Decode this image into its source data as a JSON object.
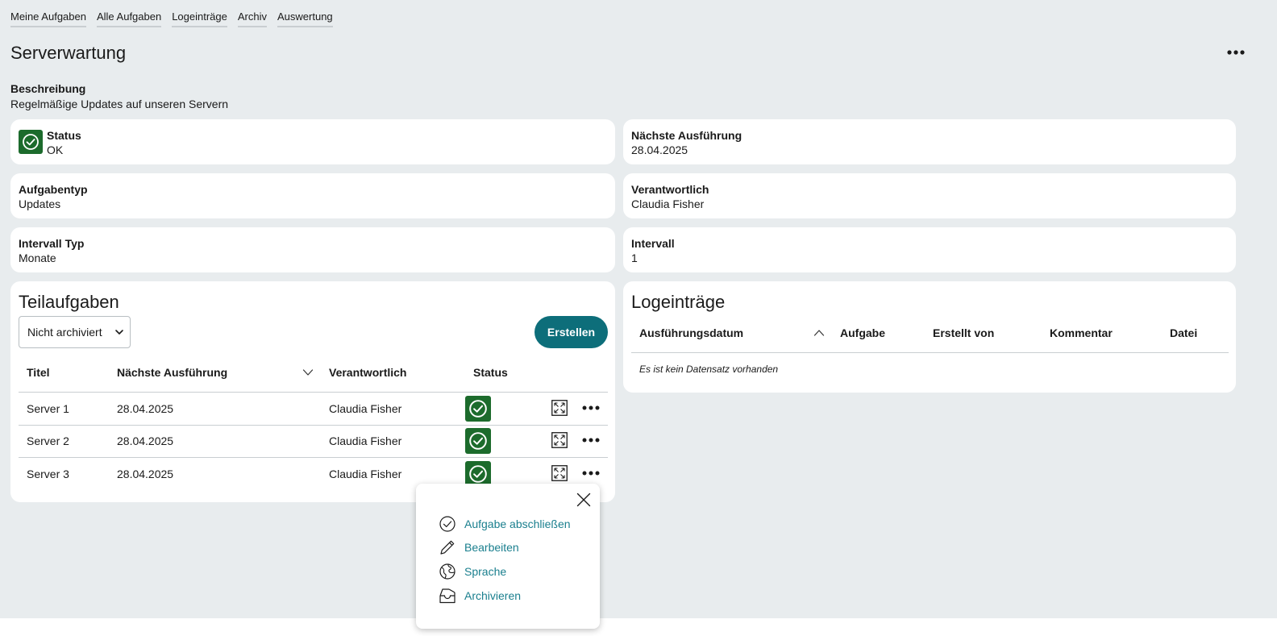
{
  "nav": {
    "items": [
      "Meine Aufgaben",
      "Alle Aufgaben",
      "Logeinträge",
      "Archiv",
      "Auswertung"
    ]
  },
  "page": {
    "title": "Serverwartung"
  },
  "description": {
    "label": "Beschreibung",
    "value": "Regelmäßige Updates auf unseren Servern"
  },
  "fields": {
    "status": {
      "label": "Status",
      "value": "OK"
    },
    "next_run": {
      "label": "Nächste Ausführung",
      "value": "28.04.2025"
    },
    "task_type": {
      "label": "Aufgabentyp",
      "value": "Updates"
    },
    "responsible": {
      "label": "Verantwortlich",
      "value": "Claudia Fisher"
    },
    "interval_type": {
      "label": "Intervall Typ",
      "value": "Monate"
    },
    "interval": {
      "label": "Intervall",
      "value": "1"
    }
  },
  "subtasks": {
    "title": "Teilaufgaben",
    "filter_selected": "Nicht archiviert",
    "create_label": "Erstellen",
    "columns": [
      "Titel",
      "Nächste Ausführung",
      "Verantwortlich",
      "Status"
    ],
    "rows": [
      {
        "title": "Server 1",
        "next_run": "28.04.2025",
        "responsible": "Claudia Fisher",
        "status": "ok"
      },
      {
        "title": "Server 2",
        "next_run": "28.04.2025",
        "responsible": "Claudia Fisher",
        "status": "ok"
      },
      {
        "title": "Server 3",
        "next_run": "28.04.2025",
        "responsible": "Claudia Fisher",
        "status": "ok"
      }
    ]
  },
  "logs": {
    "title": "Logeinträge",
    "columns": [
      "Ausführungsdatum",
      "Aufgabe",
      "Erstellt von",
      "Kommentar",
      "Datei"
    ],
    "empty_message": "Es ist kein Datensatz vorhanden"
  },
  "context_menu": {
    "items": [
      {
        "label": "Aufgabe abschließen",
        "icon": "check-circle-icon"
      },
      {
        "label": "Bearbeiten",
        "icon": "pencil-icon"
      },
      {
        "label": "Sprache",
        "icon": "globe-icon"
      },
      {
        "label": "Archivieren",
        "icon": "archive-icon"
      }
    ]
  },
  "colors": {
    "status_ok": "#1c6b2c",
    "primary_button": "#0d6e7a",
    "link": "#1a7f8e",
    "background": "#e8ecee"
  }
}
